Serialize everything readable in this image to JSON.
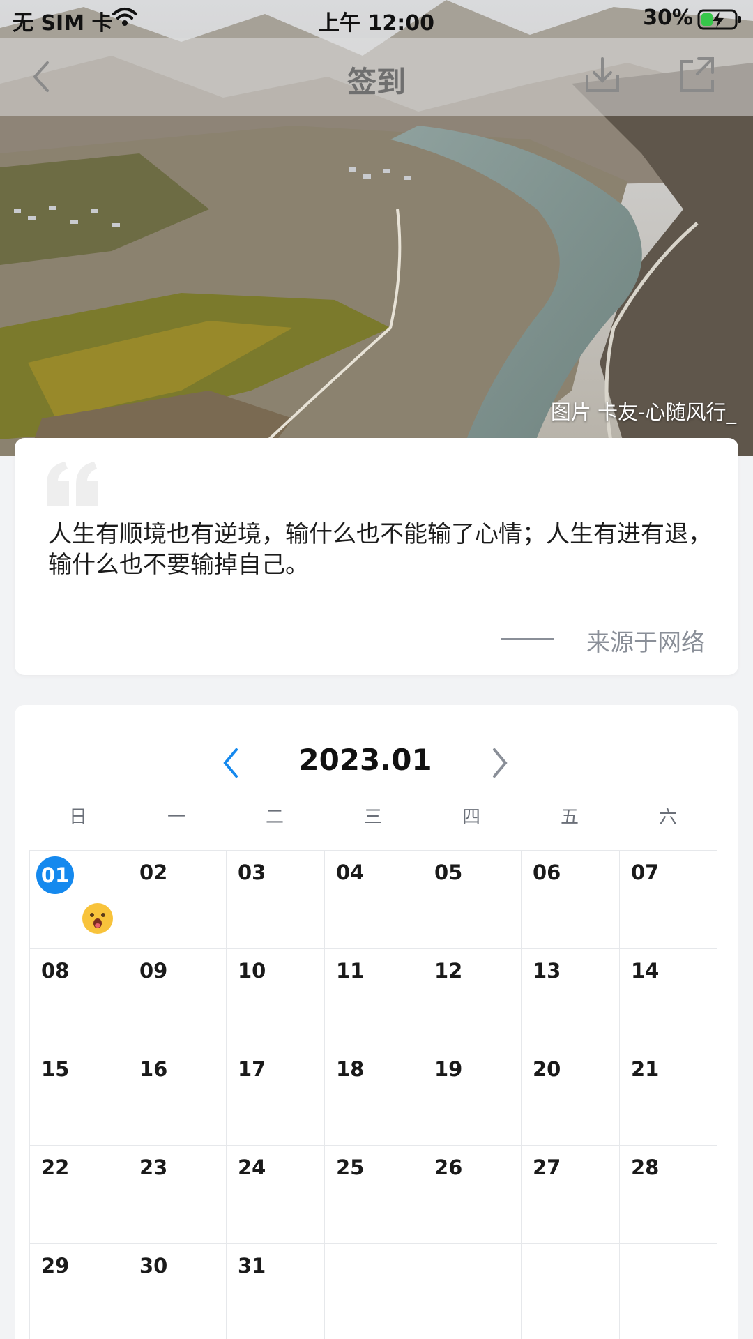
{
  "status_bar": {
    "carrier": "无 SIM 卡",
    "time": "上午 12:00",
    "battery": "30%"
  },
  "nav": {
    "title": "签到",
    "icons": [
      "back-chevron-icon",
      "download-icon",
      "share-icon"
    ]
  },
  "hero": {
    "photo_credit": "图片 卡友-心随风行_"
  },
  "quote": {
    "text": "人生有顺境也有逆境，输什么也不能输了心情；人生有进有退，输什么也不要输掉自己。",
    "source": "来源于网络"
  },
  "calendar": {
    "month": "2023.01",
    "weekdays": [
      "日",
      "一",
      "二",
      "三",
      "四",
      "五",
      "六"
    ],
    "today": "01",
    "accent_color": "#1589ee",
    "days": [
      "01",
      "02",
      "03",
      "04",
      "05",
      "06",
      "07",
      "08",
      "09",
      "10",
      "11",
      "12",
      "13",
      "14",
      "15",
      "16",
      "17",
      "18",
      "19",
      "20",
      "21",
      "22",
      "23",
      "24",
      "25",
      "26",
      "27",
      "28",
      "29",
      "30",
      "31"
    ],
    "signed_in_days": [
      "01"
    ]
  }
}
